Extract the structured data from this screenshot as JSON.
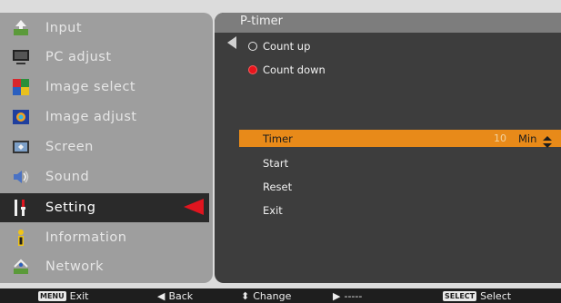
{
  "menu": {
    "items": [
      {
        "label": "Input",
        "icon": "input-icon"
      },
      {
        "label": "PC adjust",
        "icon": "pc-adjust-icon"
      },
      {
        "label": "Image select",
        "icon": "image-select-icon"
      },
      {
        "label": "Image adjust",
        "icon": "image-adjust-icon"
      },
      {
        "label": "Screen",
        "icon": "screen-icon"
      },
      {
        "label": "Sound",
        "icon": "sound-icon"
      },
      {
        "label": "Setting",
        "icon": "setting-icon"
      },
      {
        "label": "Information",
        "icon": "information-icon"
      },
      {
        "label": "Network",
        "icon": "network-icon"
      }
    ],
    "selected_index": 6
  },
  "panel": {
    "title": "P-timer",
    "options": [
      {
        "label": "Count up",
        "selected": false
      },
      {
        "label": "Count down",
        "selected": true
      }
    ],
    "items": {
      "timer_label": "Timer",
      "timer_value": "10",
      "timer_unit": "Min",
      "start": "Start",
      "reset": "Reset",
      "exit": "Exit"
    }
  },
  "footer": {
    "exit_badge": "MENU",
    "exit_label": "Exit",
    "back_label": "Back",
    "change_label": "Change",
    "next_label": "-----",
    "select_badge": "SELECT",
    "select_label": "Select"
  },
  "colors": {
    "highlight": "#e88a19",
    "pointer": "#e0151f",
    "radio_on": "#e8141c"
  }
}
